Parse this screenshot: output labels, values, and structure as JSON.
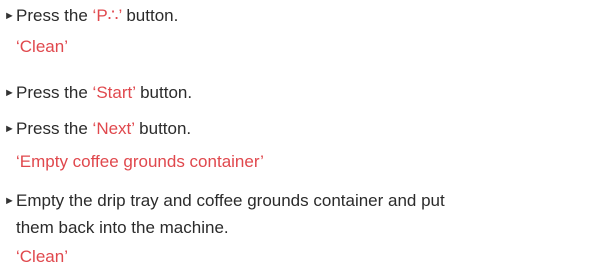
{
  "steps": [
    {
      "before": "Press the ",
      "highlight": "‘P∴’",
      "after": " button.",
      "message": "‘Clean’"
    },
    {
      "before": "Press the ",
      "highlight": "‘Start’",
      "after": " button."
    },
    {
      "before": "Press the ",
      "highlight": "‘Next’",
      "after": " button.",
      "message": "‘Empty coffee grounds container’"
    },
    {
      "line1": "Empty the drip tray and coffee grounds container and put",
      "line2": "them back into the machine.",
      "message": "‘Clean’"
    }
  ],
  "icons": {
    "bullet": "triangle-right",
    "accent_color": "#e0484d"
  }
}
